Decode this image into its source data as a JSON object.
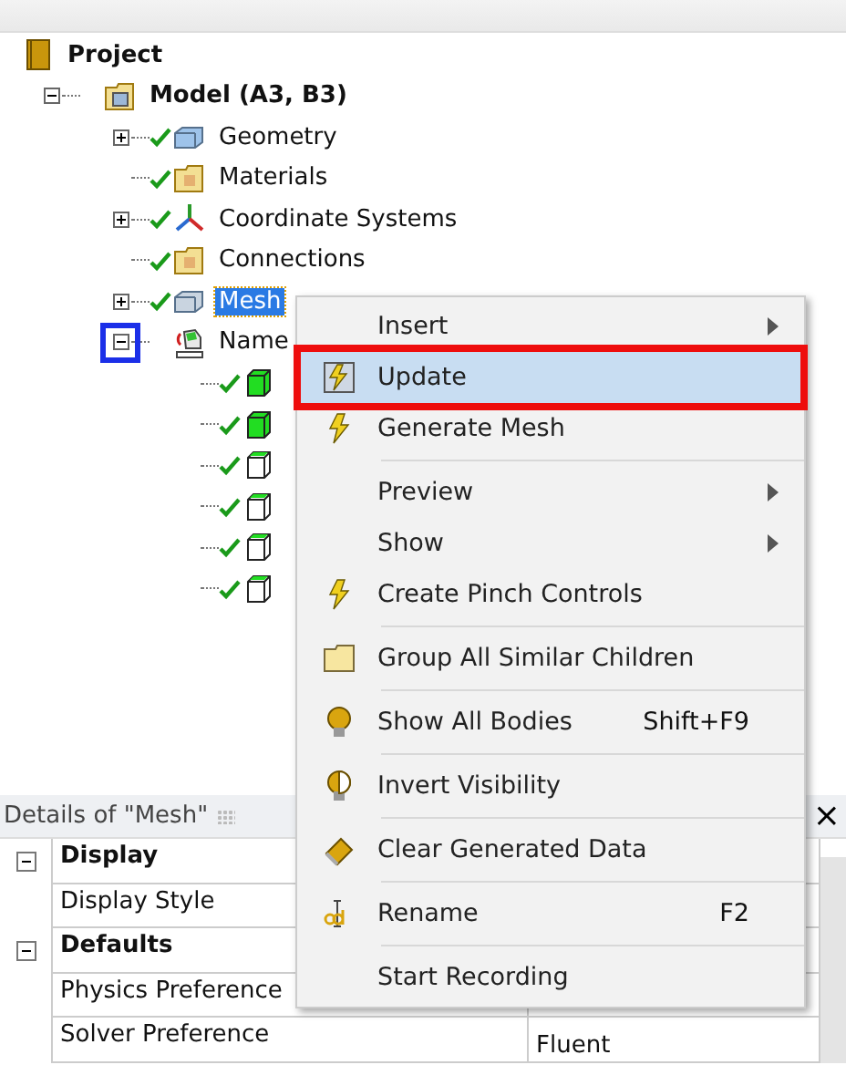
{
  "tree": [
    {
      "label": "Project",
      "kind": "project",
      "selected": false,
      "children": [
        {
          "label": "Model (A3, B3)",
          "kind": "model",
          "expanded": true,
          "selected": false,
          "children": [
            {
              "label": "Geometry",
              "kind": "geometry",
              "expanded": false,
              "checked": true,
              "selected": false
            },
            {
              "label": "Materials",
              "kind": "folder",
              "checked": true,
              "selected": false
            },
            {
              "label": "Coordinate Systems",
              "kind": "coordinates",
              "expanded": false,
              "checked": true,
              "selected": false
            },
            {
              "label": "Connections",
              "kind": "folder",
              "checked": true,
              "selected": false
            },
            {
              "label": "Mesh",
              "kind": "mesh",
              "expanded": false,
              "checked": true,
              "selected": true
            },
            {
              "label": "Name",
              "kind": "named-selections",
              "expanded": true,
              "outlined": true,
              "selected": false,
              "children": [
                {
                  "kind": "body-filled",
                  "checked": true
                },
                {
                  "kind": "body-filled",
                  "checked": true
                },
                {
                  "kind": "body-outline",
                  "checked": true
                },
                {
                  "kind": "body-outline",
                  "checked": true
                },
                {
                  "kind": "body-outline",
                  "checked": true
                },
                {
                  "kind": "body-outline",
                  "checked": true
                }
              ]
            }
          ]
        }
      ]
    }
  ],
  "context_menu": [
    {
      "kind": "plain",
      "label": "Insert",
      "submenu": true,
      "selected": false,
      "outlined": false
    },
    {
      "kind": "update",
      "label": "Update",
      "submenu": false,
      "selected": true,
      "outlined": true
    },
    {
      "kind": "lightning",
      "label": "Generate Mesh",
      "submenu": false,
      "selected": false,
      "outlined": false
    },
    {
      "kind": "separator"
    },
    {
      "kind": "plain",
      "label": "Preview",
      "submenu": true,
      "selected": false,
      "outlined": false
    },
    {
      "kind": "plain",
      "label": "Show",
      "submenu": true,
      "selected": false,
      "outlined": false
    },
    {
      "kind": "lightning",
      "label": "Create Pinch Controls",
      "submenu": false,
      "selected": false,
      "outlined": false
    },
    {
      "kind": "separator"
    },
    {
      "kind": "folder",
      "label": "Group All Similar Children",
      "submenu": false,
      "selected": false,
      "outlined": false
    },
    {
      "kind": "separator"
    },
    {
      "kind": "bulb",
      "label": "Show All Bodies",
      "shortcut": "Shift+F9",
      "submenu": false,
      "selected": false,
      "outlined": false
    },
    {
      "kind": "separator"
    },
    {
      "kind": "bulb-half",
      "label": "Invert Visibility",
      "submenu": false,
      "selected": false,
      "outlined": false
    },
    {
      "kind": "separator"
    },
    {
      "kind": "eraser",
      "label": "Clear Generated Data",
      "submenu": false,
      "selected": false,
      "outlined": false
    },
    {
      "kind": "separator"
    },
    {
      "kind": "rename",
      "label": "Rename",
      "shortcut": "F2",
      "submenu": false,
      "selected": false,
      "outlined": false
    },
    {
      "kind": "separator"
    },
    {
      "kind": "plain",
      "label": "Start Recording",
      "submenu": false,
      "selected": false,
      "outlined": false
    }
  ],
  "details": {
    "title": "Details of \"Mesh\"",
    "close": "×",
    "rows": [
      {
        "kind": "group",
        "label": "Display",
        "expanded": true
      },
      {
        "kind": "property",
        "label": "Display Style"
      },
      {
        "kind": "group",
        "label": "Defaults",
        "expanded": true
      },
      {
        "kind": "property",
        "label": "Physics Preference"
      },
      {
        "kind": "property",
        "label": "Solver Preference",
        "value": "Fluent"
      }
    ]
  }
}
